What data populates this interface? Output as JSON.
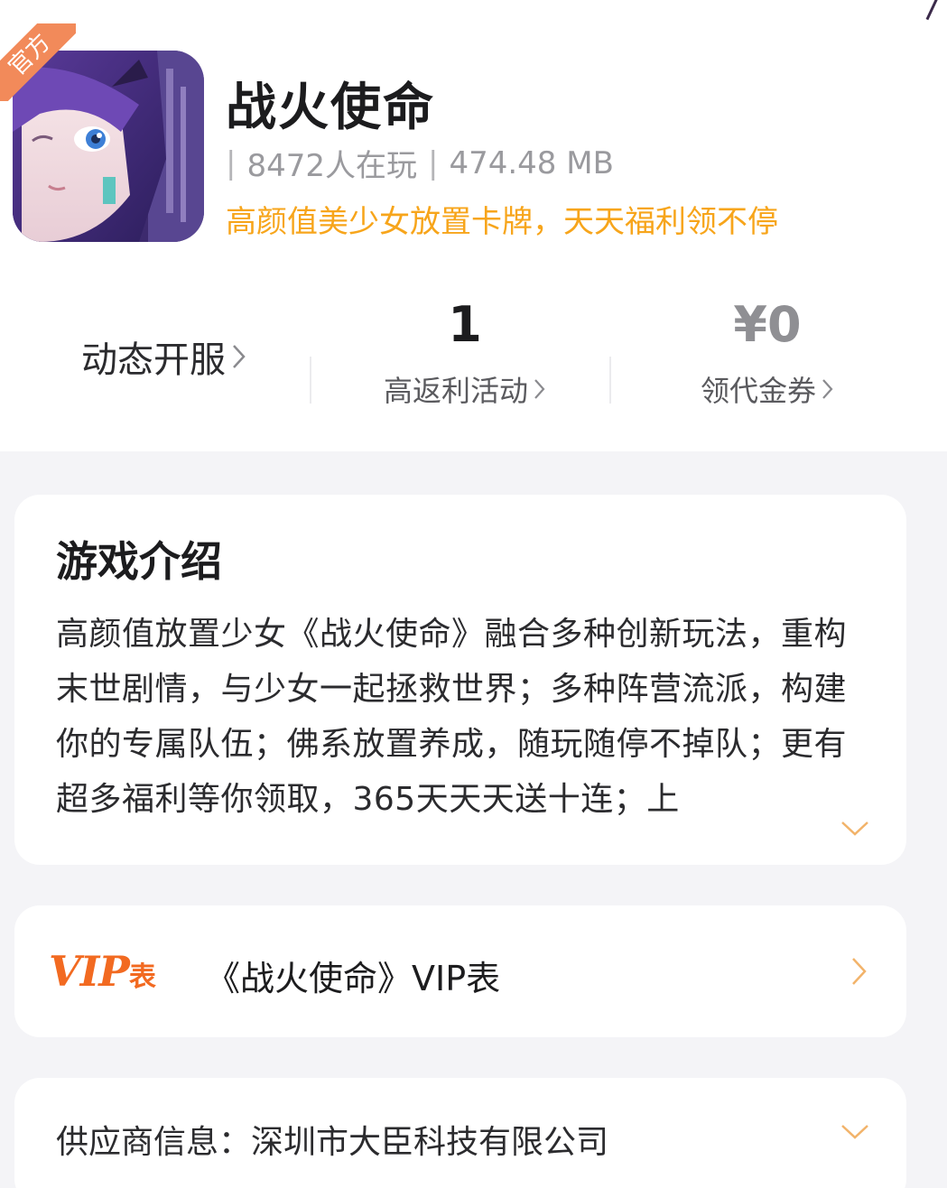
{
  "header": {
    "app_icon_name": "game-character-icon",
    "official_badge": "官方",
    "title": "战火使命",
    "meta_sep": "|",
    "players": "8472人在玩",
    "size": "474.48 MB",
    "slogan": "高颜值美少女放置卡牌，天天福利领不停"
  },
  "stats": {
    "left_label": "动态开服",
    "rebate_value": "1",
    "rebate_label": "高返利活动",
    "coupon_value": "¥0",
    "coupon_label": "领代金券"
  },
  "intro": {
    "title": "游戏介绍",
    "body": "高颜值放置少女《战火使命》融合多种创新玩法，重构末世剧情，与少女一起拯救世界；多种阵营流派，构建你的专属队伍；佛系放置养成，随玩随停不掉队；更有超多福利等你领取，365天天天送十连；上"
  },
  "vip": {
    "logo_main": "VIP",
    "logo_small": "表",
    "title": "《战火使命》VIP表"
  },
  "supplier": {
    "text": "供应商信息：深圳市大臣科技有限公司"
  },
  "colors": {
    "accent_orange": "#f7a51b",
    "vip_orange": "#f26a21",
    "badge": "#f28a5a"
  }
}
